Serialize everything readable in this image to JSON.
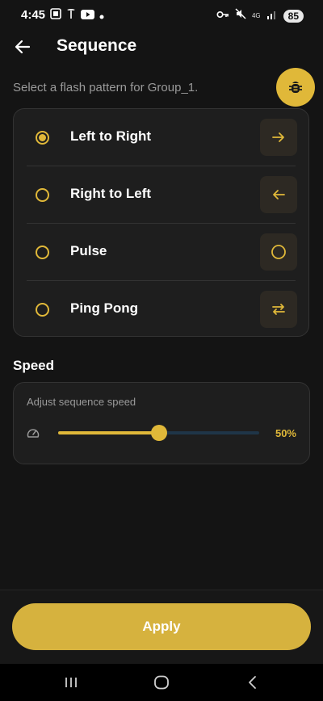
{
  "status": {
    "time": "4:45",
    "network": "4G",
    "battery": "85",
    "icons": [
      "screenshot-icon",
      "tesla-icon",
      "youtube-icon",
      "dot-icon",
      "key-icon",
      "mute-icon",
      "signal-icon",
      "battery-icon"
    ]
  },
  "header": {
    "title": "Sequence",
    "back_icon": "arrow-left-icon"
  },
  "subtitle": "Select a flash pattern for Group_1.",
  "fab": {
    "icon": "bug-icon"
  },
  "patterns": [
    {
      "label": "Left to Right",
      "selected": true,
      "icon": "arrow-right-icon"
    },
    {
      "label": "Right to Left",
      "selected": false,
      "icon": "arrow-left-icon"
    },
    {
      "label": "Pulse",
      "selected": false,
      "icon": "circle-icon"
    },
    {
      "label": "Ping Pong",
      "selected": false,
      "icon": "swap-arrows-icon"
    }
  ],
  "speed": {
    "heading": "Speed",
    "description": "Adjust sequence speed",
    "value_label": "50%",
    "value": 0.5,
    "icon": "gauge-icon"
  },
  "apply_label": "Apply",
  "colors": {
    "accent": "#e0b839",
    "background": "#141414",
    "card": "#1e1e1e",
    "track": "#1f3548"
  },
  "nav": {
    "icons": [
      "recents-icon",
      "home-icon",
      "back-icon"
    ]
  }
}
